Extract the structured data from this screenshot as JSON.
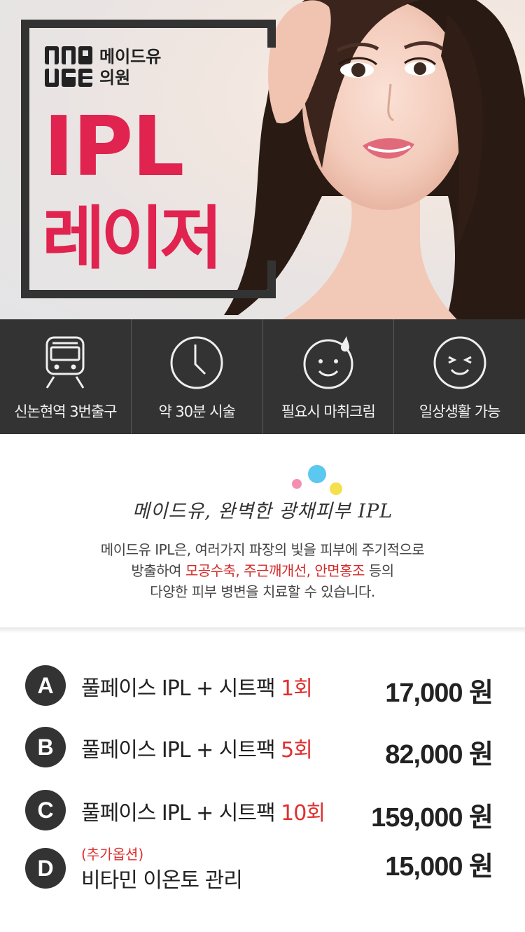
{
  "hero": {
    "logo_line1": "메이드유",
    "logo_line2": "의원",
    "title_line1": "IPL",
    "title_line2": "레이저",
    "accent_color": "#e0234f"
  },
  "features": [
    {
      "icon": "train-icon",
      "label": "신논현역 3번출구"
    },
    {
      "icon": "clock-icon",
      "label": "약 30분 시술"
    },
    {
      "icon": "smile-sweat-icon",
      "label": "필요시 마취크림"
    },
    {
      "icon": "happy-face-icon",
      "label": "일상생활 가능"
    }
  ],
  "intro": {
    "heading": "메이드유, 완벽한 광채피부 IPL",
    "line1": "메이드유 IPL은, 여러가지 파장의 빛을 피부에 주기적으로",
    "line2_pre": "방출하여 ",
    "line2_hl1": "모공수축",
    "line2_sep1": ", ",
    "line2_hl2": "주근깨개선",
    "line2_sep2": ", ",
    "line2_hl3": "안면홍조",
    "line2_post": " 등의",
    "line3": "다양한 피부 병변을 치료할 수 있습니다."
  },
  "prices": [
    {
      "badge": "A",
      "name": "풀페이스 IPL + 시트팩 ",
      "count": "1회",
      "price": "17,000 원"
    },
    {
      "badge": "B",
      "name": "풀페이스 IPL  + 시트팩 ",
      "count": "5회",
      "price": "82,000 원"
    },
    {
      "badge": "C",
      "name": "풀페이스 IPL  + 시트팩 ",
      "count": "10회",
      "price": "159,000 원"
    },
    {
      "badge": "D",
      "sub": "(추가옵션)",
      "name": "비타민 이온토 관리",
      "price": "15,000 원"
    }
  ]
}
